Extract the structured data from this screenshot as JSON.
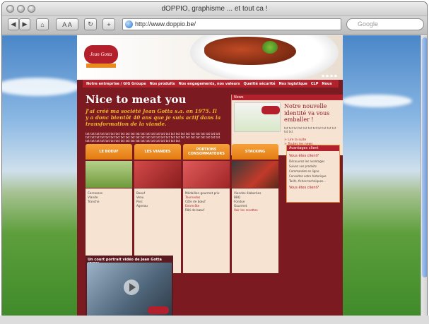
{
  "window": {
    "title": "dOPPIO, graphisme ... et tout ca !"
  },
  "toolbar": {
    "url": "http://www.doppio.be/",
    "search_placeholder": "Google",
    "text_size_label": "A A"
  },
  "site": {
    "logo_text": "Jean Gotta",
    "lang_flags": "▪ ▪ ▪ ▪",
    "nav": [
      "Notre entreprise / GIG Groupe",
      "Nos produits",
      "Nos engagements, nos valeurs",
      "Qualité sécurité",
      "Nos logistique",
      "CLP",
      "Nous"
    ],
    "headline": "Nice to meat you",
    "intro": "J'ai créé ma société Jean Gotta s.a. en 1975. Il y a donc bientôt 40 ans que je suis actif dans la transformation de la viande.",
    "body": "txt txt txt txt txt txt txt txt txt txt txt txt txt txt txt txt txt txt txt txt txt txt txt txt txt txt txt txt txt txt txt txt txt txt txt txt txt txt txt txt txt txt txt txt txt txt txt txt txt txt txt txt txt txt txt txt txt txt txt txt txt txt txt txt txt txt txt txt txt txt txt txt txt",
    "news": {
      "label": "News",
      "title": "Notre nouvelle identité va vous emballer !",
      "text": "txt txt txt txt txt txt txt txt txt txt txt txt txt",
      "links": [
        "> Lire la suite",
        "> Toutes les news"
      ]
    },
    "columns": [
      {
        "tab": "LE BOEUF",
        "items": [
          "Carcasses",
          "Viande",
          "Tranche"
        ]
      },
      {
        "tab": "LES VIANDES",
        "items": [
          "Boeuf",
          "Veau",
          "Porc",
          "Agneau"
        ]
      },
      {
        "tab": "PORTIONS CONSOMMATEURS",
        "items": [
          "Médaillon gourmet prix",
          "Tournedos",
          "Côte de bœuf",
          "Entrecôte",
          "Rôti de bœuf"
        ]
      },
      {
        "tab": "STACKING",
        "items": [
          "Viandes élaborées",
          "BBQ",
          "Fondue",
          "Gourmet",
          "Voir les recettes"
        ]
      }
    ],
    "sidebox": {
      "label": "Avantages client",
      "title": "Vous êtes client?",
      "text": "Découvrez les avantages",
      "list": [
        "Suivez vos produits",
        "Commandez en ligne",
        "Consultez votre historique",
        "Tarifs, fiches techniques..."
      ],
      "link": "Vous êtes client?"
    },
    "video": {
      "title": "Un court portrait vidéo de Jean Gotta (7'33)"
    }
  }
}
